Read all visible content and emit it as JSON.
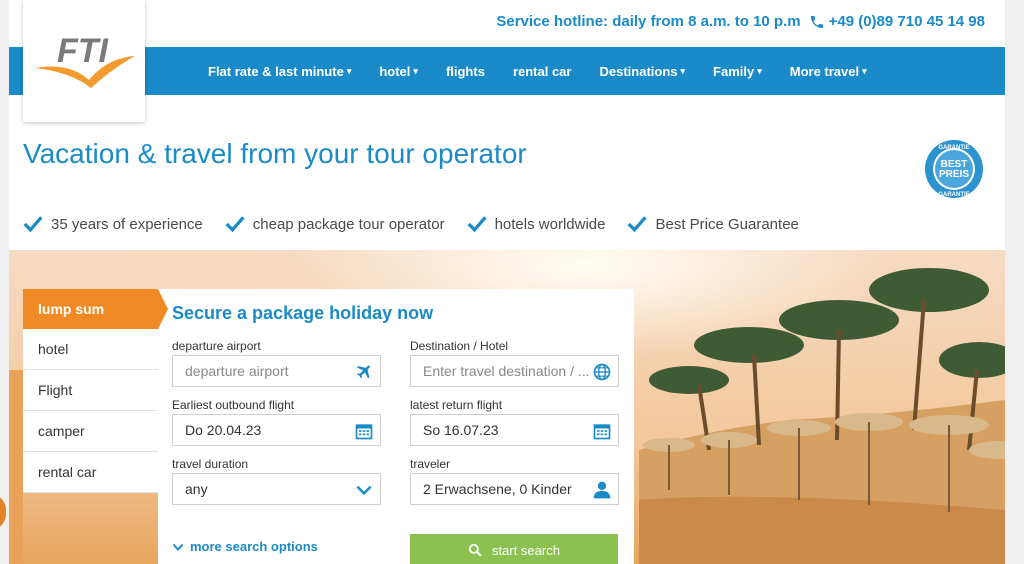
{
  "header": {
    "hotline": "Service hotline: daily from 8 a.m. to 10 p.m",
    "phone": "+49 (0)89 710 45 14 98",
    "logo_text": "FTI"
  },
  "nav": {
    "items": [
      {
        "label": "Flat rate & last minute",
        "caret": true
      },
      {
        "label": "hotel",
        "caret": true
      },
      {
        "label": "flights",
        "caret": false
      },
      {
        "label": "rental car",
        "caret": false
      },
      {
        "label": "Destinations",
        "caret": true
      },
      {
        "label": "Family",
        "caret": true
      },
      {
        "label": "More travel",
        "caret": true
      }
    ]
  },
  "headline": "Vacation & travel from your tour operator",
  "badge": {
    "top": "GARANTIE",
    "line1": "BEST",
    "line2": "PREIS",
    "bottom": "GARANTIE"
  },
  "usps": [
    "35 years of experience",
    "cheap package tour operator",
    "hotels worldwide",
    "Best Price Guarantee"
  ],
  "tabs": [
    "lump sum",
    "hotel",
    "Flight",
    "camper",
    "rental car"
  ],
  "search": {
    "title": "Secure a package holiday now",
    "departure_label": "departure airport",
    "departure_placeholder": "departure airport",
    "destination_label": "Destination / Hotel",
    "destination_placeholder": "Enter travel destination / ...",
    "outbound_label": "Earliest outbound flight",
    "outbound_value": "Do 20.04.23",
    "return_label": "latest return flight",
    "return_value": "So 16.07.23",
    "duration_label": "travel duration",
    "duration_value": "any",
    "traveler_label": "traveler",
    "traveler_value": "2 Erwachsene, 0 Kinder",
    "more_options": "more search options",
    "search_button": "start search"
  },
  "colors": {
    "brand_blue": "#1a8bc8",
    "accent_orange": "#f08a24",
    "button_green": "#8cc152"
  }
}
